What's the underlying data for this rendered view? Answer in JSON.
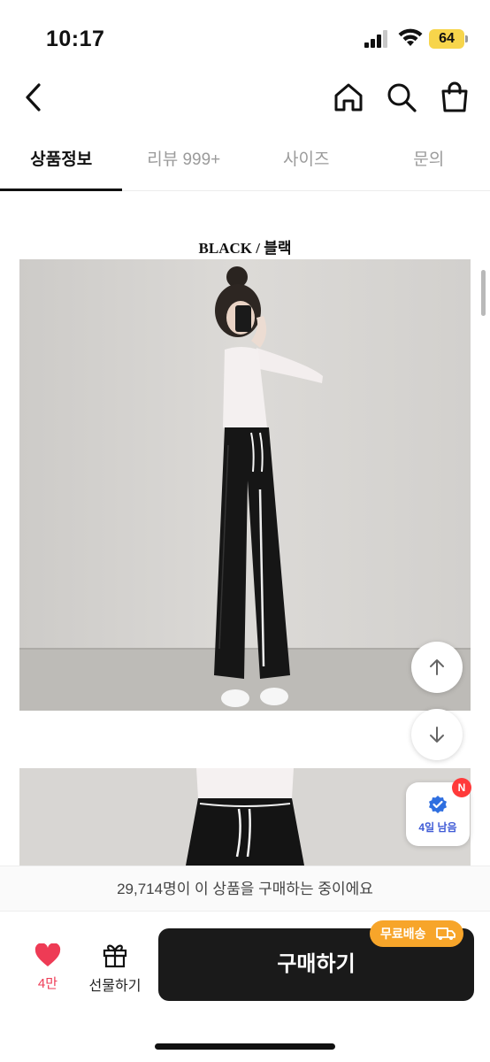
{
  "status_bar": {
    "time": "10:17",
    "battery": "64"
  },
  "tabs": [
    {
      "label": "상품정보",
      "active": true
    },
    {
      "label": "리뷰 999+",
      "active": false
    },
    {
      "label": "사이즈",
      "active": false
    },
    {
      "label": "문의",
      "active": false
    }
  ],
  "content": {
    "image_caption": "BLACK / 블랙"
  },
  "coupon": {
    "badge": "N",
    "label": "4일 남음"
  },
  "notice": {
    "text": "29,714명이 이 상품을 구매하는 중이에요"
  },
  "bottom_bar": {
    "like_count": "4만",
    "gift_label": "선물하기",
    "buy_label": "구매하기",
    "free_shipping_label": "무료배송"
  },
  "colors": {
    "accent_like": "#ee3b55",
    "buy_button": "#1a1a1a",
    "free_ship_badge": "#f7a52a",
    "verified": "#2f6fe0"
  }
}
